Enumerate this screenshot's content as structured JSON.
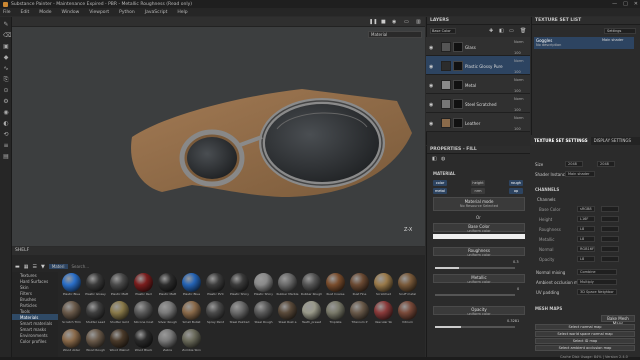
{
  "window": {
    "title": "Substance Painter - Maintenance Expired - PBR - Metallic Roughness (Read only)",
    "controls": [
      "—",
      "□",
      "✕"
    ]
  },
  "menu": [
    "File",
    "Edit",
    "Mode",
    "Window",
    "Viewport",
    "Python",
    "JavaScript",
    "Help"
  ],
  "viewport": {
    "mode": "Material",
    "axis": "Z-X"
  },
  "shelf": {
    "title": "SHELF",
    "filter": "Materi",
    "search_placeholder": "Search...",
    "categories": [
      "Textures",
      "Hard Surfaces",
      "Skin",
      "Filters",
      "Brushes",
      "Particles",
      "Tools",
      "Materials",
      "Smart materials",
      "Smart masks",
      "Environments",
      "Color profiles"
    ],
    "selected_category": "Materials",
    "materials": [
      {
        "name": "Plastic Blue",
        "color": "#2a6fc9"
      },
      {
        "name": "Plastic Glossy",
        "color": "#3a3a3a"
      },
      {
        "name": "Plastic Matt",
        "color": "#4a4a4a"
      },
      {
        "name": "Plastic Red",
        "color": "#7a1d1d"
      },
      {
        "name": "Plastic Matt",
        "color": "#2c2c2c"
      },
      {
        "name": "Plastic Blue",
        "color": "#2463b4"
      },
      {
        "name": "Plastic PVC",
        "color": "#3d3d3d"
      },
      {
        "name": "Plastic Shiny",
        "color": "#3a3a3a"
      },
      {
        "name": "Plastic Shiny",
        "color": "#8a8a8a"
      },
      {
        "name": "Rubber Marble",
        "color": "#6a6a6a"
      },
      {
        "name": "Rubber Rough",
        "color": "#555"
      },
      {
        "name": "Rust Coarse",
        "color": "#7a4d2d"
      },
      {
        "name": "Rust Fine",
        "color": "#6b4a33"
      },
      {
        "name": "Scratched",
        "color": "#9a7a4a"
      },
      {
        "name": "Scuff metal",
        "color": "#7a5a3a"
      },
      {
        "name": "Scratch Trim",
        "color": "#6a5a4a"
      },
      {
        "name": "Shutter Lead",
        "color": "#3f3f3f"
      },
      {
        "name": "Shutter Gold",
        "color": "#8a7a4a"
      },
      {
        "name": "Silicone Coat",
        "color": "#5a5a5a"
      },
      {
        "name": "Silver Rough",
        "color": "#7a7a7a"
      },
      {
        "name": "Small Bullet",
        "color": "#8a6a4a"
      },
      {
        "name": "Spray Paint",
        "color": "#4a4a4a"
      },
      {
        "name": "Steel Painted",
        "color": "#6a6a6a"
      },
      {
        "name": "Steel Rough",
        "color": "#5a5a5a"
      },
      {
        "name": "Steel Rust a",
        "color": "#5a4a3a"
      },
      {
        "name": "Teeth_preset",
        "color": "#9a9a8a"
      },
      {
        "name": "Tinplate",
        "color": "#7a7a6a"
      },
      {
        "name": "Titanium P",
        "color": "#6a5a4a"
      },
      {
        "name": "Vascular Sk",
        "color": "#8a3a3a"
      },
      {
        "name": "Vitrium",
        "color": "#7a4a3a"
      },
      {
        "name": "Wood Alder",
        "color": "#8a6a4a"
      },
      {
        "name": "Wood Rough",
        "color": "#6a5a4a"
      },
      {
        "name": "Wood Walnut",
        "color": "#4a3a2a"
      },
      {
        "name": "Wood Black",
        "color": "#2a2a2a"
      },
      {
        "name": "Zebra",
        "color": "#7a7a7a"
      },
      {
        "name": "Zombie Skin",
        "color": "#6a6a5a"
      }
    ]
  },
  "layers": {
    "title": "LAYERS",
    "channel": "Base Color",
    "items": [
      {
        "name": "Glass",
        "blend": "Norm",
        "opacity": "100",
        "thumb": "#555",
        "mask": "#111"
      },
      {
        "name": "Plastic Glossy Pure",
        "blend": "Norm",
        "opacity": "100",
        "thumb": "#2c2c2c",
        "mask": "#111",
        "selected": true
      },
      {
        "name": "Metal",
        "blend": "Norm",
        "opacity": "100",
        "thumb": "#8a8a8a",
        "mask": "#111"
      },
      {
        "name": "Steel Scratched",
        "blend": "Norm",
        "opacity": "100",
        "thumb": "#777",
        "mask": "#111"
      },
      {
        "name": "Leather",
        "blend": "Norm",
        "opacity": "100",
        "thumb": "#8a6a4a",
        "mask": "#111"
      }
    ]
  },
  "texture_set_list": {
    "title": "TEXTURE SET LIST",
    "settings_label": "Settings",
    "set_name": "Goggles",
    "set_desc": "No description",
    "shader": "Main shader"
  },
  "texture_set_settings": {
    "tabs": [
      "TEXTURE SET SETTINGS",
      "DISPLAY SETTINGS"
    ],
    "size_label": "Size",
    "size_value": "2048",
    "size_value2": "2048",
    "shader_label": "Shader Instance",
    "shader_value": "Main shader",
    "channels_title": "CHANNELS",
    "channels_sub": "Channels",
    "channels": [
      {
        "name": "Base Color",
        "fmt": "sRGB8"
      },
      {
        "name": "Height",
        "fmt": "L16F"
      },
      {
        "name": "Roughness",
        "fmt": "L8"
      },
      {
        "name": "Metallic",
        "fmt": "L8"
      },
      {
        "name": "Normal",
        "fmt": "RGB16F"
      },
      {
        "name": "Opacity",
        "fmt": "L8"
      }
    ],
    "normal_mixing_label": "Normal mixing",
    "normal_mixing_value": "Combine",
    "ao_label": "Ambient occlusion mixing",
    "ao_value": "Multiply",
    "uv_label": "UV padding",
    "uv_value": "3D Space Neighbor",
    "mesh_maps_title": "MESH MAPS",
    "bake_btn": "Bake Mesh Maps",
    "mesh_buttons": [
      "Select normal map",
      "Select world space normal map",
      "Select ID map",
      "Select ambient occlusion map"
    ]
  },
  "properties": {
    "title": "PROPERTIES - FILL",
    "material_title": "MATERIAL",
    "chips": [
      "color",
      "height",
      "rough",
      "metal",
      "nrm",
      "op"
    ],
    "material_mode": "Material mode",
    "no_resource": "No Resource Selected",
    "or": "Or",
    "base_color": "Base Color",
    "uniform": "uniform color",
    "roughness": "Roughness",
    "roughness_val": "0.3",
    "metallic": "Metallic",
    "metallic_val": "0",
    "opacity": "Opacity",
    "opacity_val": "0.3281"
  },
  "status": {
    "text": "Cache Disk Usage: 84% | Version 2.4.0"
  }
}
